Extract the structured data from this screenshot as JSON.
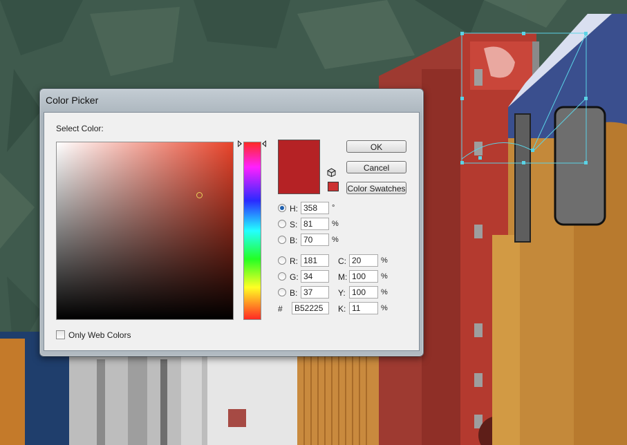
{
  "dialog": {
    "title": "Color Picker",
    "select_color_label": "Select Color:",
    "field_color_hue": "#e8432a",
    "selected_color_hex": "#B52225",
    "websafe_swatch_color": "#cc3333",
    "buttons": {
      "ok": "OK",
      "cancel": "Cancel",
      "color_swatches": "Color Swatches"
    },
    "hsb": {
      "h": {
        "label": "H:",
        "value": "358",
        "unit": "°",
        "selected": true
      },
      "s": {
        "label": "S:",
        "value": "81",
        "unit": "%",
        "selected": false
      },
      "b": {
        "label": "B:",
        "value": "70",
        "unit": "%",
        "selected": false
      }
    },
    "rgb": {
      "r": {
        "label": "R:",
        "value": "181"
      },
      "g": {
        "label": "G:",
        "value": "34"
      },
      "b": {
        "label": "B:",
        "value": "37"
      }
    },
    "cmyk": {
      "c": {
        "label": "C:",
        "value": "20",
        "unit": "%"
      },
      "m": {
        "label": "M:",
        "value": "100",
        "unit": "%"
      },
      "y": {
        "label": "Y:",
        "value": "100",
        "unit": "%"
      },
      "k": {
        "label": "K:",
        "value": "11",
        "unit": "%"
      }
    },
    "hex": {
      "label": "#",
      "value": "B52225"
    },
    "only_web_colors_label": "Only Web Colors",
    "only_web_colors_checked": false
  },
  "icons": {
    "cube": "cube-icon",
    "hue_slider_left": "triangle-right-icon",
    "hue_slider_right": "triangle-left-icon"
  }
}
